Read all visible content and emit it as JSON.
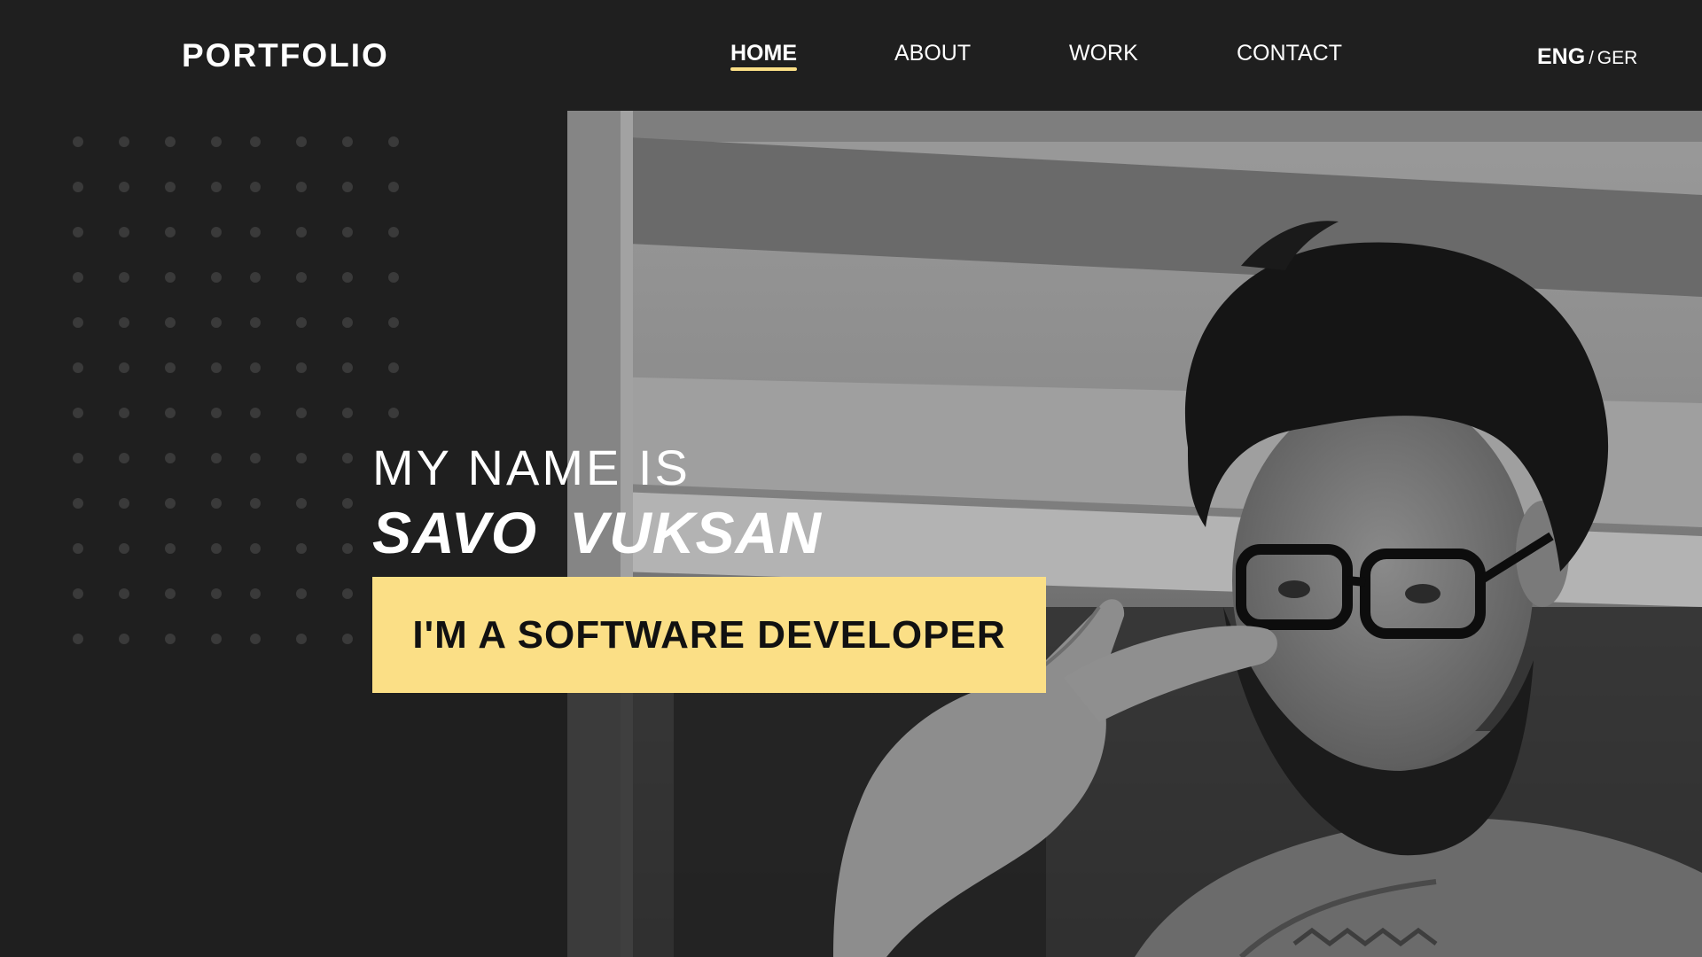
{
  "colors": {
    "background": "#1f1f1f",
    "accent": "#fbdf86",
    "text": "#ffffff",
    "dark_text": "#111111",
    "dots": "#3a3a3a"
  },
  "header": {
    "logo": "PORTFOLIO",
    "nav": [
      {
        "label": "HOME",
        "active": true
      },
      {
        "label": "ABOUT",
        "active": false
      },
      {
        "label": "WORK",
        "active": false
      },
      {
        "label": "CONTACT",
        "active": false
      }
    ],
    "lang": {
      "current": "ENG",
      "separator": "/",
      "other": "GER"
    }
  },
  "hero": {
    "intro": "MY NAME IS",
    "first_name": "SAVO",
    "last_name": "VUKSAN",
    "role": "I'M A SOFTWARE DEVELOPER"
  },
  "photo": {
    "icon": "portrait-photo"
  }
}
